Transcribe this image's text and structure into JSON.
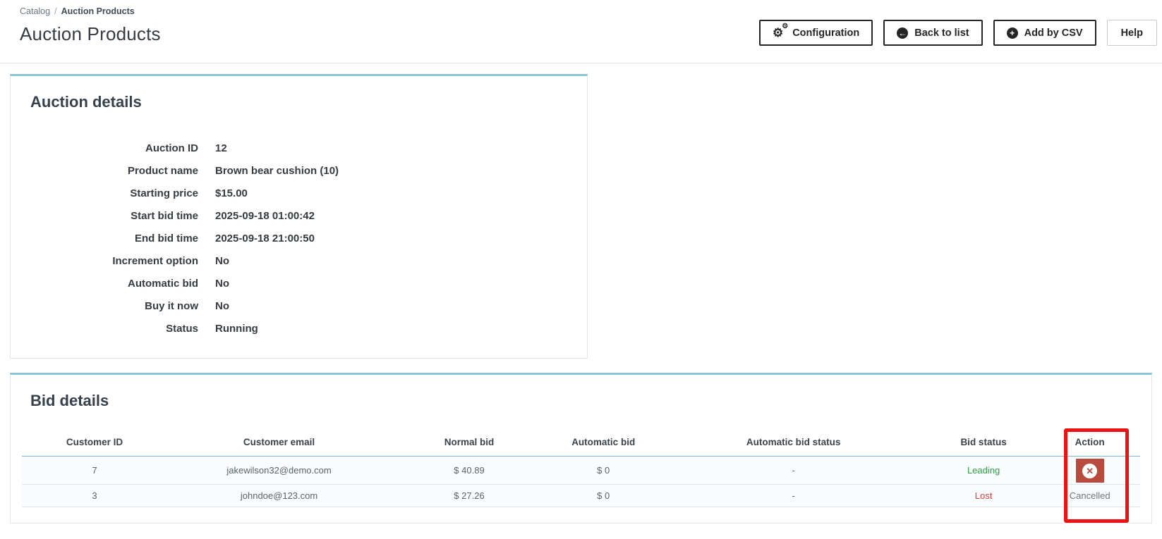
{
  "breadcrumb": {
    "parent": "Catalog",
    "separator": "/",
    "current": "Auction Products"
  },
  "page_title": "Auction Products",
  "toolbar": {
    "configuration_label": "Configuration",
    "back_to_list_label": "Back to list",
    "add_by_csv_label": "Add by CSV",
    "help_label": "Help"
  },
  "icons": {
    "gear": "⚙",
    "back_arrow": "←",
    "plus": "+",
    "cancel_x": "✕"
  },
  "auction_details": {
    "title": "Auction details",
    "fields": [
      {
        "label": "Auction ID",
        "value": "12"
      },
      {
        "label": "Product name",
        "value": "Brown bear cushion (10)"
      },
      {
        "label": "Starting price",
        "value": "$15.00"
      },
      {
        "label": "Start bid time",
        "value": "2025-09-18 01:00:42"
      },
      {
        "label": "End bid time",
        "value": "2025-09-18 21:00:50"
      },
      {
        "label": "Increment option",
        "value": "No"
      },
      {
        "label": "Automatic bid",
        "value": "No"
      },
      {
        "label": "Buy it now",
        "value": "No"
      },
      {
        "label": "Status",
        "value": "Running"
      }
    ]
  },
  "bid_details": {
    "title": "Bid details",
    "columns": [
      "Customer ID",
      "Customer email",
      "Normal bid",
      "Automatic bid",
      "Automatic bid status",
      "Bid status",
      "Action"
    ],
    "rows": [
      {
        "customer_id": "7",
        "customer_email": "jakewilson32@demo.com",
        "normal_bid": "$ 40.89",
        "automatic_bid": "$ 0",
        "automatic_bid_status": "-",
        "bid_status": "Leading",
        "action": "cancel-bid-button"
      },
      {
        "customer_id": "3",
        "customer_email": "johndoe@123.com",
        "normal_bid": "$ 27.26",
        "automatic_bid": "$ 0",
        "automatic_bid_status": "-",
        "bid_status": "Lost",
        "action": "Cancelled"
      }
    ]
  },
  "annotation": {
    "type": "highlight-rectangle",
    "target": "Action column",
    "color": "#ec1212"
  },
  "colors": {
    "panel_accent_teal": "#8cc5d5",
    "table_header_underline": "#7db8ca",
    "leading_green": "#2f9e44",
    "lost_red": "#e03c3c",
    "cancel_button_red": "#b94a3e",
    "annotation_red": "#ec1212",
    "button_border_dark": "#252525"
  }
}
